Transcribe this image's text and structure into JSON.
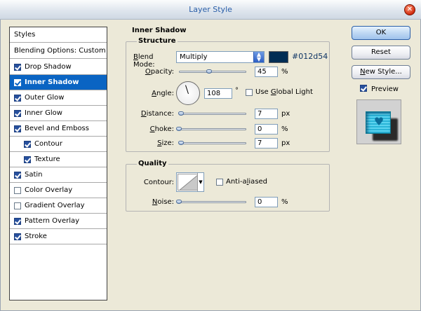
{
  "window": {
    "title": "Layer Style"
  },
  "styles_panel": {
    "header": "Styles",
    "blending_options": "Blending Options: Custom",
    "items": [
      {
        "label": "Drop Shadow",
        "checked": true,
        "selected": false,
        "sub": false
      },
      {
        "label": "Inner Shadow",
        "checked": true,
        "selected": true,
        "sub": false
      },
      {
        "label": "Outer Glow",
        "checked": true,
        "selected": false,
        "sub": false
      },
      {
        "label": "Inner Glow",
        "checked": true,
        "selected": false,
        "sub": false
      },
      {
        "label": "Bevel and Emboss",
        "checked": true,
        "selected": false,
        "sub": false
      },
      {
        "label": "Contour",
        "checked": true,
        "selected": false,
        "sub": true
      },
      {
        "label": "Texture",
        "checked": true,
        "selected": false,
        "sub": true
      },
      {
        "label": "Satin",
        "checked": true,
        "selected": false,
        "sub": false
      },
      {
        "label": "Color Overlay",
        "checked": false,
        "selected": false,
        "sub": false
      },
      {
        "label": "Gradient Overlay",
        "checked": false,
        "selected": false,
        "sub": false
      },
      {
        "label": "Pattern Overlay",
        "checked": true,
        "selected": false,
        "sub": false
      },
      {
        "label": "Stroke",
        "checked": true,
        "selected": false,
        "sub": false
      }
    ]
  },
  "inner_shadow": {
    "section_title": "Inner Shadow",
    "structure": {
      "title": "Structure",
      "blend_mode_label": "Blend Mode:",
      "blend_mode_value": "Multiply",
      "color_hex": "#012d54",
      "opacity_label": "Opacity:",
      "opacity_value": "45",
      "opacity_unit": "%",
      "angle_label": "Angle:",
      "angle_value": "108",
      "angle_unit": "°",
      "global_light_label": "Use Global Light",
      "global_light_checked": false,
      "distance_label": "Distance:",
      "distance_value": "7",
      "distance_unit": "px",
      "choke_label": "Choke:",
      "choke_value": "0",
      "choke_unit": "%",
      "size_label": "Size:",
      "size_value": "7",
      "size_unit": "px"
    },
    "quality": {
      "title": "Quality",
      "contour_label": "Contour:",
      "anti_aliased_label": "Anti-aliased",
      "anti_aliased_checked": false,
      "noise_label": "Noise:",
      "noise_value": "0",
      "noise_unit": "%"
    }
  },
  "buttons": {
    "ok": "OK",
    "reset": "Reset",
    "new_style": "New Style...",
    "preview_label": "Preview",
    "preview_checked": true
  },
  "colors": {
    "selection": "#0a64c3",
    "shadow_color": "#012d54"
  }
}
